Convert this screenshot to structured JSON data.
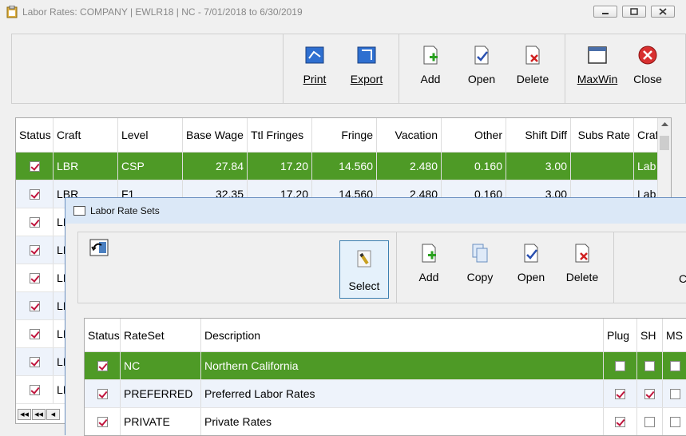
{
  "main_window": {
    "title": "Labor Rates: COMPANY | EWLR18 | NC -  7/01/2018 to  6/30/2019",
    "toolbar": {
      "print": "Print",
      "export": "Export",
      "add": "Add",
      "open": "Open",
      "delete": "Delete",
      "maxwin": "MaxWin",
      "close": "Close"
    },
    "grid": {
      "columns": [
        "Status",
        "Craft",
        "Level",
        "Base Wage",
        "Ttl Fringes",
        "Fringe",
        "Vacation",
        "Other",
        "Shift Diff",
        "Subs Rate",
        "Craft"
      ],
      "rows": [
        {
          "status": true,
          "craft": "LBR",
          "level": "CSP",
          "base_wage": "27.84",
          "ttl_fringes": "17.20",
          "fringe": "14.560",
          "vacation": "2.480",
          "other": "0.160",
          "shift_diff": "3.00",
          "subs_rate": "",
          "craft2": "Lab"
        },
        {
          "status": true,
          "craft": "LBR",
          "level": "F1",
          "base_wage": "32.35",
          "ttl_fringes": "17.20",
          "fringe": "14.560",
          "vacation": "2.480",
          "other": "0.160",
          "shift_diff": "3.00",
          "subs_rate": "",
          "craft2": "Lab"
        },
        {
          "status": true,
          "craft": "LI"
        },
        {
          "status": true,
          "craft": "LI"
        },
        {
          "status": true,
          "craft": "LI"
        },
        {
          "status": true,
          "craft": "LI"
        },
        {
          "status": true,
          "craft": "LI"
        },
        {
          "status": true,
          "craft": "LI"
        },
        {
          "status": true,
          "craft": "LI"
        }
      ]
    }
  },
  "rateset_window": {
    "title": "Labor Rate Sets",
    "toolbar": {
      "select": "Select",
      "add": "Add",
      "copy": "Copy",
      "open": "Open",
      "delete": "Delete",
      "close_partial": "C"
    },
    "grid": {
      "columns": [
        "Status",
        "RateSet",
        "Description",
        "Plug",
        "SH",
        "MS"
      ],
      "rows": [
        {
          "status": true,
          "rateset": "NC",
          "description": "Northern California",
          "plug": false,
          "sh": false,
          "ms": false
        },
        {
          "status": true,
          "rateset": "PREFERRED",
          "description": "Preferred Labor Rates",
          "plug": true,
          "sh": true,
          "ms": false
        },
        {
          "status": true,
          "rateset": "PRIVATE",
          "description": "Private Rates",
          "plug": true,
          "sh": false,
          "ms": false
        }
      ]
    }
  },
  "colors": {
    "selected_row": "#4e9a26",
    "check_mark": "#c0143c"
  }
}
